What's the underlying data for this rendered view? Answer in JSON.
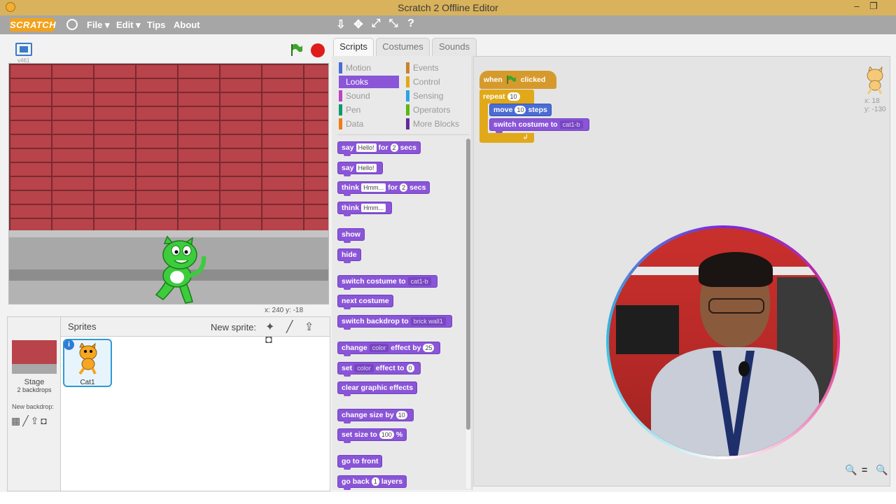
{
  "window": {
    "title": "Scratch 2 Offline Editor",
    "minimize": "–",
    "restore": "❐"
  },
  "menubar": {
    "logo": "SCRATCH",
    "menus": [
      "File ▾",
      "Edit ▾",
      "Tips",
      "About"
    ],
    "tools": [
      "⇩",
      "✥",
      "⤢",
      "⤡",
      "?"
    ]
  },
  "stage": {
    "version": "v461",
    "coords": "x: 240   y: -18"
  },
  "sprites_panel": {
    "title": "Sprites",
    "new_sprite": "New sprite:",
    "new_sprite_icons": "✦ ╱ ⇪ ◘",
    "stage_label": "Stage",
    "stage_backdrops": "2 backdrops",
    "new_backdrop": "New backdrop:",
    "new_backdrop_icons": "▦╱⇪◘",
    "sprites": [
      {
        "name": "Cat1",
        "info": "i"
      }
    ]
  },
  "tabs": [
    "Scripts",
    "Costumes",
    "Sounds"
  ],
  "categories": [
    {
      "label": "Motion",
      "color": "#4a6cd4"
    },
    {
      "label": "Looks",
      "color": "#8a55d7"
    },
    {
      "label": "Sound",
      "color": "#bb42c3"
    },
    {
      "label": "Pen",
      "color": "#0e9a6c"
    },
    {
      "label": "Data",
      "color": "#ee7d16"
    },
    {
      "label": "Events",
      "color": "#c88330"
    },
    {
      "label": "Control",
      "color": "#e1a91a"
    },
    {
      "label": "Sensing",
      "color": "#2ca5e2"
    },
    {
      "label": "Operators",
      "color": "#5cb712"
    },
    {
      "label": "More Blocks",
      "color": "#632d99"
    }
  ],
  "blocks": {
    "say_for": {
      "a": "say",
      "v1": "Hello!",
      "b": "for",
      "v2": "2",
      "c": "secs"
    },
    "say": {
      "a": "say",
      "v1": "Hello!"
    },
    "think_for": {
      "a": "think",
      "v1": "Hmm...",
      "b": "for",
      "v2": "2",
      "c": "secs"
    },
    "think": {
      "a": "think",
      "v1": "Hmm..."
    },
    "show": "show",
    "hide": "hide",
    "switch_costume": {
      "a": "switch costume to",
      "v1": "cat1-b"
    },
    "next_costume": "next costume",
    "switch_backdrop": {
      "a": "switch backdrop to",
      "v1": "brick wall1"
    },
    "change_effect": {
      "a": "change",
      "v1": "color",
      "b": "effect by",
      "v2": "25"
    },
    "set_effect": {
      "a": "set",
      "v1": "color",
      "b": "effect to",
      "v2": "0"
    },
    "clear_effects": "clear graphic effects",
    "change_size": {
      "a": "change size by",
      "v1": "10"
    },
    "set_size": {
      "a": "set size to",
      "v1": "100",
      "b": "%"
    },
    "go_front": "go to front",
    "go_back": {
      "a": "go back",
      "v1": "1",
      "b": "layers"
    }
  },
  "script": {
    "hat_a": "when",
    "hat_b": "clicked",
    "repeat": "repeat",
    "repeat_val": "10",
    "move_a": "move",
    "move_val": "10",
    "move_b": "steps",
    "switch_a": "switch costume to",
    "switch_val": "cat1-b",
    "loop_arrow": "↲"
  },
  "sprite_xy": {
    "x": "x: 18",
    "y": "y: -130"
  },
  "zoom": [
    "🔍",
    "=",
    "🔍"
  ]
}
